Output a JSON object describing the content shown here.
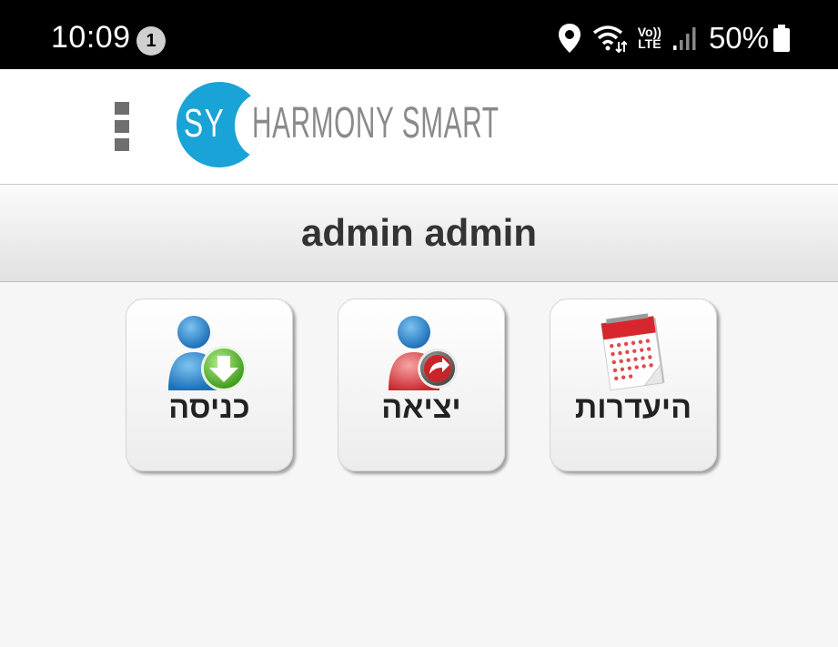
{
  "status_bar": {
    "time": "10:09",
    "notification_count": "1",
    "volte_top": "Vo))",
    "volte_bottom": "LTE",
    "battery_percent": "50%"
  },
  "header": {
    "logo_mark": "SY",
    "logo_text": "HARMONY SMART",
    "brand_color": "#1aa3d6"
  },
  "title": "admin admin",
  "tiles": [
    {
      "label": "כניסה",
      "icon": "user-check-in-icon"
    },
    {
      "label": "יציאה",
      "icon": "user-check-out-icon"
    },
    {
      "label": "היעדרות",
      "icon": "calendar-icon"
    }
  ],
  "colors": {
    "status_bar": "#000000",
    "title_text": "#333333"
  }
}
